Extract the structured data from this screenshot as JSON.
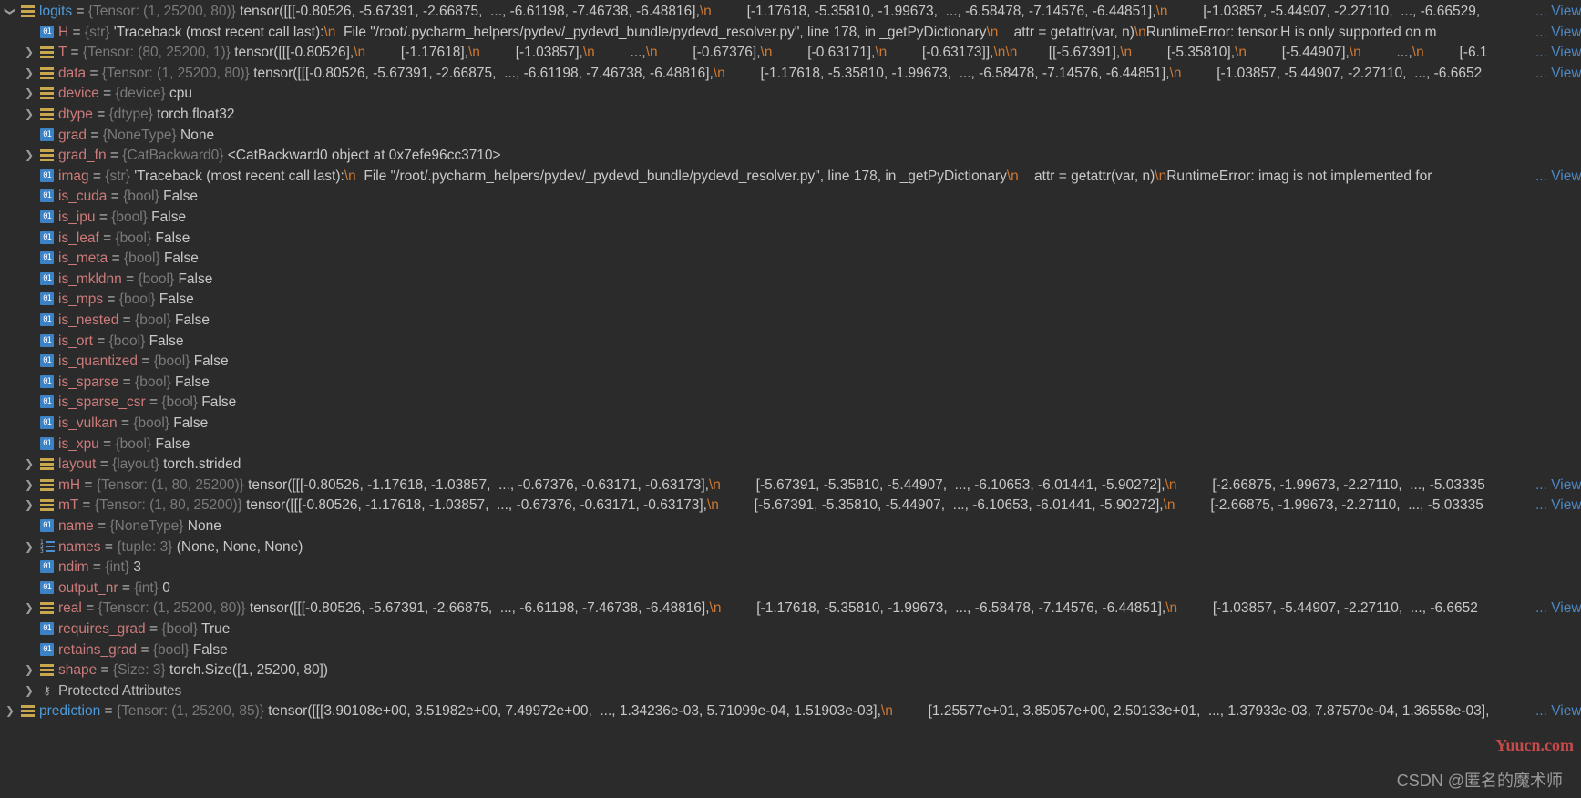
{
  "tree": [
    {
      "indent": 0,
      "expander": "open",
      "icon": "obj",
      "name": "logits",
      "top": true,
      "type": "{Tensor: (1, 25200, 80)}",
      "value": "tensor([[[-0.80526, -5.67391, -2.66875,  ..., -6.61198, -7.46738, -6.48816],\\n         [-1.17618, -5.35810, -1.99673,  ..., -6.58478, -7.14576, -6.44851],\\n         [-1.03857, -5.44907, -2.27110,  ..., -6.66529,",
      "view": true
    },
    {
      "indent": 1,
      "expander": "none",
      "icon": "prim",
      "name": "H",
      "type": "{str}",
      "value": "'Traceback (most recent call last):\\n  File \"/root/.pycharm_helpers/pydev/_pydevd_bundle/pydevd_resolver.py\", line 178, in _getPyDictionary\\n    attr = getattr(var, n)\\nRuntimeError: tensor.H is only supported on m",
      "view": true
    },
    {
      "indent": 1,
      "expander": "closed",
      "icon": "obj",
      "name": "T",
      "type": "{Tensor: (80, 25200, 1)}",
      "value": "tensor([[[-0.80526],\\n         [-1.17618],\\n         [-1.03857],\\n         ...,\\n         [-0.67376],\\n         [-0.63171],\\n         [-0.63173]],\\n\\n        [[-5.67391],\\n         [-5.35810],\\n         [-5.44907],\\n         ...,\\n         [-6.1",
      "view": true
    },
    {
      "indent": 1,
      "expander": "closed",
      "icon": "obj",
      "name": "data",
      "type": "{Tensor: (1, 25200, 80)}",
      "value": "tensor([[[-0.80526, -5.67391, -2.66875,  ..., -6.61198, -7.46738, -6.48816],\\n         [-1.17618, -5.35810, -1.99673,  ..., -6.58478, -7.14576, -6.44851],\\n         [-1.03857, -5.44907, -2.27110,  ..., -6.6652",
      "view": true
    },
    {
      "indent": 1,
      "expander": "closed",
      "icon": "obj",
      "name": "device",
      "type": "{device}",
      "value": "cpu",
      "view": false
    },
    {
      "indent": 1,
      "expander": "closed",
      "icon": "obj",
      "name": "dtype",
      "type": "{dtype}",
      "value": "torch.float32",
      "view": false
    },
    {
      "indent": 1,
      "expander": "none",
      "icon": "prim",
      "name": "grad",
      "type": "{NoneType}",
      "value": "None",
      "view": false
    },
    {
      "indent": 1,
      "expander": "closed",
      "icon": "obj",
      "name": "grad_fn",
      "type": "{CatBackward0}",
      "value": "<CatBackward0 object at 0x7efe96cc3710>",
      "view": false
    },
    {
      "indent": 1,
      "expander": "none",
      "icon": "prim",
      "name": "imag",
      "type": "{str}",
      "value": "'Traceback (most recent call last):\\n  File \"/root/.pycharm_helpers/pydev/_pydevd_bundle/pydevd_resolver.py\", line 178, in _getPyDictionary\\n    attr = getattr(var, n)\\nRuntimeError: imag is not implemented for",
      "view": true
    },
    {
      "indent": 1,
      "expander": "none",
      "icon": "prim",
      "name": "is_cuda",
      "type": "{bool}",
      "value": "False",
      "view": false
    },
    {
      "indent": 1,
      "expander": "none",
      "icon": "prim",
      "name": "is_ipu",
      "type": "{bool}",
      "value": "False",
      "view": false
    },
    {
      "indent": 1,
      "expander": "none",
      "icon": "prim",
      "name": "is_leaf",
      "type": "{bool}",
      "value": "False",
      "view": false
    },
    {
      "indent": 1,
      "expander": "none",
      "icon": "prim",
      "name": "is_meta",
      "type": "{bool}",
      "value": "False",
      "view": false
    },
    {
      "indent": 1,
      "expander": "none",
      "icon": "prim",
      "name": "is_mkldnn",
      "type": "{bool}",
      "value": "False",
      "view": false
    },
    {
      "indent": 1,
      "expander": "none",
      "icon": "prim",
      "name": "is_mps",
      "type": "{bool}",
      "value": "False",
      "view": false
    },
    {
      "indent": 1,
      "expander": "none",
      "icon": "prim",
      "name": "is_nested",
      "type": "{bool}",
      "value": "False",
      "view": false
    },
    {
      "indent": 1,
      "expander": "none",
      "icon": "prim",
      "name": "is_ort",
      "type": "{bool}",
      "value": "False",
      "view": false
    },
    {
      "indent": 1,
      "expander": "none",
      "icon": "prim",
      "name": "is_quantized",
      "type": "{bool}",
      "value": "False",
      "view": false
    },
    {
      "indent": 1,
      "expander": "none",
      "icon": "prim",
      "name": "is_sparse",
      "type": "{bool}",
      "value": "False",
      "view": false
    },
    {
      "indent": 1,
      "expander": "none",
      "icon": "prim",
      "name": "is_sparse_csr",
      "type": "{bool}",
      "value": "False",
      "view": false
    },
    {
      "indent": 1,
      "expander": "none",
      "icon": "prim",
      "name": "is_vulkan",
      "type": "{bool}",
      "value": "False",
      "view": false
    },
    {
      "indent": 1,
      "expander": "none",
      "icon": "prim",
      "name": "is_xpu",
      "type": "{bool}",
      "value": "False",
      "view": false
    },
    {
      "indent": 1,
      "expander": "closed",
      "icon": "obj",
      "name": "layout",
      "type": "{layout}",
      "value": "torch.strided",
      "view": false
    },
    {
      "indent": 1,
      "expander": "closed",
      "icon": "obj",
      "name": "mH",
      "type": "{Tensor: (1, 80, 25200)}",
      "value": "tensor([[[-0.80526, -1.17618, -1.03857,  ..., -0.67376, -0.63171, -0.63173],\\n         [-5.67391, -5.35810, -5.44907,  ..., -6.10653, -6.01441, -5.90272],\\n         [-2.66875, -1.99673, -2.27110,  ..., -5.03335",
      "view": true
    },
    {
      "indent": 1,
      "expander": "closed",
      "icon": "obj",
      "name": "mT",
      "type": "{Tensor: (1, 80, 25200)}",
      "value": "tensor([[[-0.80526, -1.17618, -1.03857,  ..., -0.67376, -0.63171, -0.63173],\\n         [-5.67391, -5.35810, -5.44907,  ..., -6.10653, -6.01441, -5.90272],\\n         [-2.66875, -1.99673, -2.27110,  ..., -5.03335",
      "view": true
    },
    {
      "indent": 1,
      "expander": "none",
      "icon": "prim",
      "name": "name",
      "type": "{NoneType}",
      "value": "None",
      "view": false
    },
    {
      "indent": 1,
      "expander": "closed",
      "icon": "tuple",
      "name": "names",
      "type": "{tuple: 3}",
      "value": "(None, None, None)",
      "view": false
    },
    {
      "indent": 1,
      "expander": "none",
      "icon": "prim",
      "name": "ndim",
      "type": "{int}",
      "value": "3",
      "view": false
    },
    {
      "indent": 1,
      "expander": "none",
      "icon": "prim",
      "name": "output_nr",
      "type": "{int}",
      "value": "0",
      "view": false
    },
    {
      "indent": 1,
      "expander": "closed",
      "icon": "obj",
      "name": "real",
      "type": "{Tensor: (1, 25200, 80)}",
      "value": "tensor([[[-0.80526, -5.67391, -2.66875,  ..., -6.61198, -7.46738, -6.48816],\\n         [-1.17618, -5.35810, -1.99673,  ..., -6.58478, -7.14576, -6.44851],\\n         [-1.03857, -5.44907, -2.27110,  ..., -6.6652",
      "view": true
    },
    {
      "indent": 1,
      "expander": "none",
      "icon": "prim",
      "name": "requires_grad",
      "type": "{bool}",
      "value": "True",
      "view": false
    },
    {
      "indent": 1,
      "expander": "none",
      "icon": "prim",
      "name": "retains_grad",
      "type": "{bool}",
      "value": "False",
      "view": false
    },
    {
      "indent": 1,
      "expander": "closed",
      "icon": "obj",
      "name": "shape",
      "type": "{Size: 3}",
      "value": "torch.Size([1, 25200, 80])",
      "view": false
    },
    {
      "indent": 1,
      "expander": "closed",
      "icon": "key",
      "name": "Protected Attributes",
      "plain": true,
      "type": "",
      "value": "",
      "view": false
    },
    {
      "indent": 0,
      "expander": "closed",
      "icon": "obj",
      "name": "prediction",
      "top": true,
      "type": "{Tensor: (1, 25200, 85)}",
      "value": "tensor([[[3.90108e+00, 3.51982e+00, 7.49972e+00,  ..., 1.34236e-03, 5.71099e-04, 1.51903e-03],\\n         [1.25577e+01, 3.85057e+00, 2.50133e+01,  ..., 1.37933e-03, 7.87570e-04, 1.36558e-03],",
      "view": true
    }
  ],
  "labels": {
    "view": "... View",
    "equals": "=",
    "prim_icon_text": "01",
    "tuple_icon_nums": [
      "1",
      "2",
      "3"
    ],
    "key_icon_glyph": "⚷"
  },
  "watermarks": {
    "site": "Yuucn.com",
    "credit": "CSDN @匿名的魔术师"
  },
  "colors": {
    "background": "#2b2b2b",
    "top_level_name": "#4d9bdb",
    "attribute_name": "#cc7a7a",
    "type_hint": "#7a7a7a",
    "newline_escape": "#cc7832",
    "view_link": "#4d88c4",
    "primitive_icon": "#3d82c4",
    "object_icon": "#c9a74e"
  },
  "icons": {
    "obj": "stacked-bars-icon",
    "prim": "primitive-01-icon",
    "tuple": "tuple-list-icon",
    "key": "key-icon",
    "expander_open": "chevron-down-icon",
    "expander_closed": "chevron-right-icon"
  }
}
